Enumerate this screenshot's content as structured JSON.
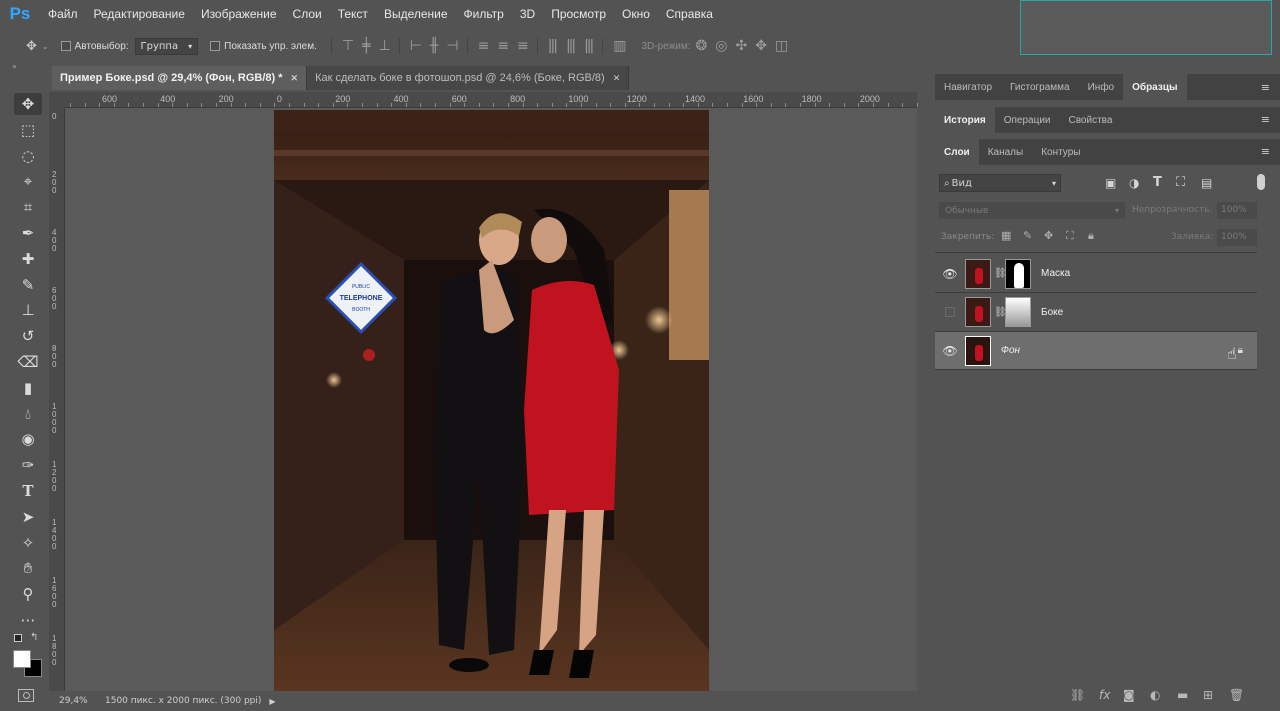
{
  "app": {
    "logo": "Ps"
  },
  "menu": [
    "Файл",
    "Редактирование",
    "Изображение",
    "Слои",
    "Текст",
    "Выделение",
    "Фильтр",
    "3D",
    "Просмотр",
    "Окно",
    "Справка"
  ],
  "options": {
    "autoselect_label": "Автовыбор:",
    "autoselect_value": "Группа",
    "show_transform_label": "Показать упр. элем.",
    "mode3d_label": "3D-режим:"
  },
  "tabs": [
    {
      "label": "Пример Боке.psd @ 29,4% (Фон, RGB/8) *",
      "active": true
    },
    {
      "label": "Как сделать боке в фотошоп.psd @ 24,6% (Боке, RGB/8)",
      "active": false
    }
  ],
  "ruler": {
    "h_ticks": [
      "600",
      "400",
      "200",
      "0",
      "200",
      "400",
      "600",
      "800",
      "1000",
      "1200",
      "1400",
      "1600",
      "1800",
      "2000"
    ],
    "v_ticks": [
      "0",
      "2 0 0",
      "4 0 0",
      "6 0 0",
      "8 0 0",
      "1 0 0 0",
      "1 2 0 0",
      "1 4 0 0",
      "1 6 0 0",
      "1 8 0 0"
    ]
  },
  "photo": {
    "sign_line1": "PUBLIC",
    "sign_line2": "TELEPHONE",
    "sign_line3": "BOOTH"
  },
  "status": {
    "zoom": "29,4%",
    "doc_info": "1500 пикс. x 2000 пикс. (300 ppi)"
  },
  "panels": {
    "row1": [
      {
        "label": "Навигатор",
        "active": false
      },
      {
        "label": "Гистограмма",
        "active": false
      },
      {
        "label": "Инфо",
        "active": false
      },
      {
        "label": "Образцы",
        "active": true
      }
    ],
    "row2": [
      {
        "label": "История",
        "active": true
      },
      {
        "label": "Операции",
        "active": false
      },
      {
        "label": "Свойства",
        "active": false
      }
    ],
    "row3": [
      {
        "label": "Слои",
        "active": true
      },
      {
        "label": "Каналы",
        "active": false
      },
      {
        "label": "Контуры",
        "active": false
      }
    ]
  },
  "layers_panel": {
    "filter_label": "Вид",
    "blend_mode": "Обычные",
    "opacity_label": "Непрозрачность:",
    "opacity_value": "100%",
    "lock_label": "Закрепить:",
    "fill_label": "Заливка:",
    "fill_value": "100%",
    "layers": [
      {
        "name": "Маска",
        "visible": true,
        "mask": "silhouette",
        "selected": false
      },
      {
        "name": "Боке",
        "visible": false,
        "mask": "gradient",
        "selected": false
      },
      {
        "name": "Фон",
        "visible": true,
        "mask": "none",
        "selected": true,
        "locked": true
      }
    ]
  },
  "colors": {
    "accent": "#31a8ff",
    "panel_bg": "#535353",
    "dark_bg": "#424242",
    "dress_red": "#c0131f"
  }
}
